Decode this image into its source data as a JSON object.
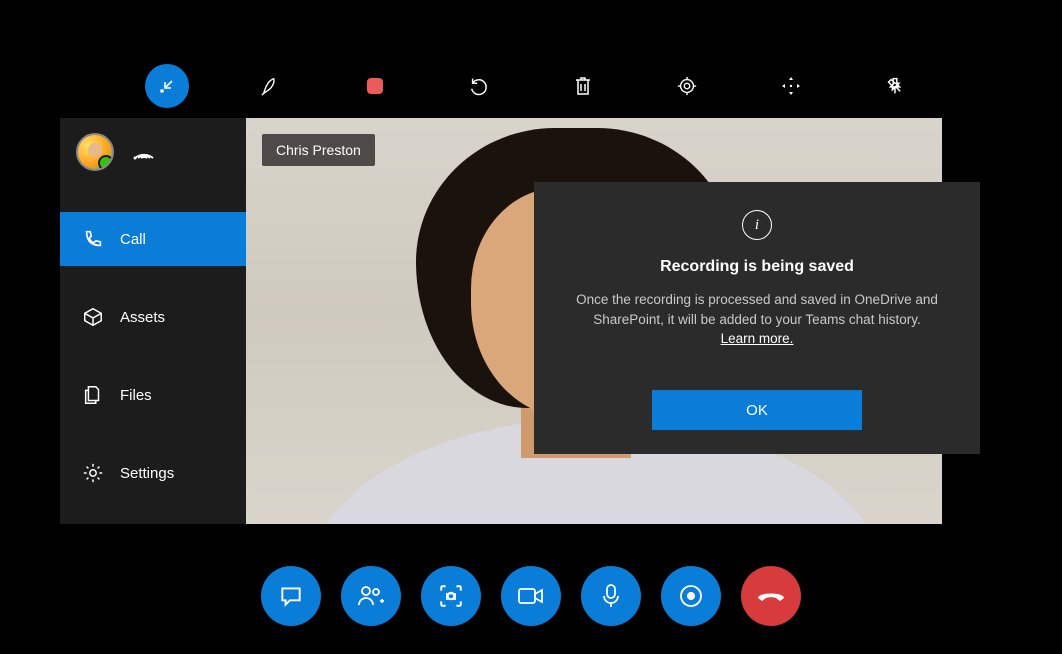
{
  "colors": {
    "accent": "#0a7dd8",
    "danger": "#d83b3b",
    "surface": "#2b2b2b",
    "sidebar": "#1c1c1c"
  },
  "top_toolbar": [
    {
      "name": "collapse-icon",
      "active": true
    },
    {
      "name": "pen-icon"
    },
    {
      "name": "record-stop-icon"
    },
    {
      "name": "undo-icon"
    },
    {
      "name": "trash-icon"
    },
    {
      "name": "target-icon"
    },
    {
      "name": "move-arrows-icon"
    },
    {
      "name": "pin-icon"
    }
  ],
  "sidebar": {
    "items": [
      {
        "icon": "phone-icon",
        "label": "Call",
        "active": true
      },
      {
        "icon": "package-icon",
        "label": "Assets"
      },
      {
        "icon": "files-icon",
        "label": "Files"
      },
      {
        "icon": "gear-icon",
        "label": "Settings"
      }
    ]
  },
  "video": {
    "participant_name": "Chris Preston"
  },
  "modal": {
    "title": "Recording is being saved",
    "body": "Once the recording is processed and saved in OneDrive and SharePoint, it will be added to your Teams chat history.",
    "link": "Learn more.",
    "ok": "OK"
  },
  "call_controls": [
    {
      "name": "chat-icon"
    },
    {
      "name": "add-people-icon"
    },
    {
      "name": "capture-icon"
    },
    {
      "name": "video-icon"
    },
    {
      "name": "mic-icon"
    },
    {
      "name": "record-icon"
    },
    {
      "name": "hang-up-icon",
      "end": true
    }
  ]
}
